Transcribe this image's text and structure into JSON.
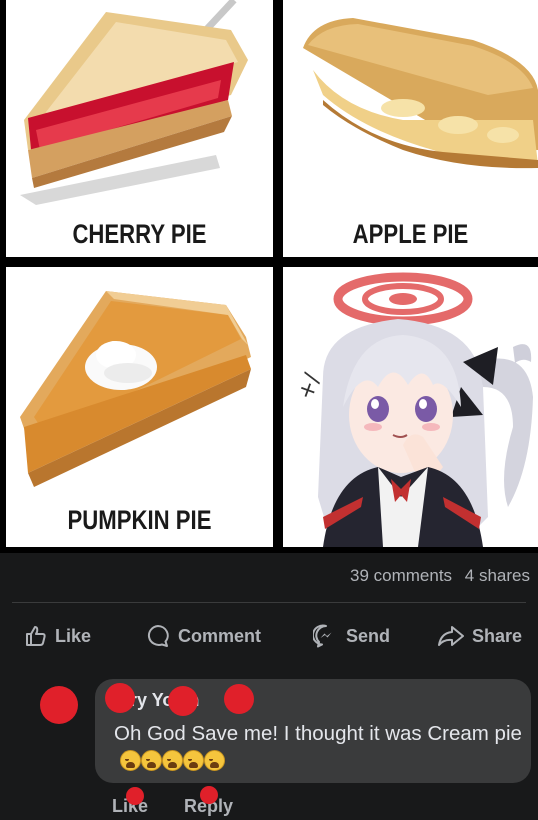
{
  "meme": {
    "panels": [
      {
        "caption": "CHERRY PIE"
      },
      {
        "caption": "APPLE PIE"
      },
      {
        "caption": "PUMPKIN PIE"
      },
      {
        "caption": ""
      }
    ],
    "anime_mark": "+/"
  },
  "stats": {
    "comments": "39 comments",
    "shares": "4 shares"
  },
  "actions": {
    "like": "Like",
    "comment": "Comment",
    "send": "Send",
    "share": "Share"
  },
  "comment": {
    "author": "mry  Yo  sh",
    "text": "Oh God Save me! I thought it was Cream pie",
    "emoji_count": 5,
    "like_label": "Like",
    "reply_label": "Reply"
  },
  "colors": {
    "background": "#18191a",
    "bubble": "#3a3b3c",
    "text": "#e4e6eb",
    "muted": "#b0b3b8",
    "redaction": "#e0202a"
  }
}
